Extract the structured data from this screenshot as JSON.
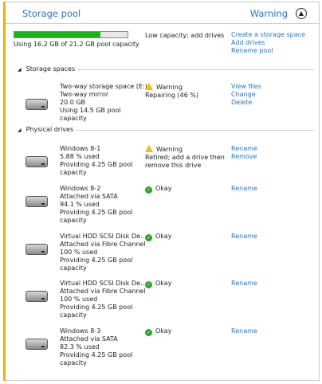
{
  "header": {
    "title": "Storage pool",
    "status": "Warning",
    "collapse_icon": "chevron-up-icon"
  },
  "pool": {
    "usage_fraction": 0.764,
    "usage_text": "Using 16.2 GB of 21.2 GB pool capacity",
    "capacity_warning": "Low capacity; add drives",
    "actions": [
      "Create a storage space",
      "Add drives",
      "Rename pool"
    ]
  },
  "storage_spaces": {
    "heading": "Storage spaces",
    "items": [
      {
        "lines": [
          "Two-way storage space (E:)",
          "Two-way mirror",
          "20.0 GB",
          "Using 14.5 GB pool capacity"
        ],
        "state": [
          "Warning",
          "Repairing (46 %)"
        ],
        "actions": [
          "View files",
          "Change",
          "Delete"
        ]
      }
    ]
  },
  "physical_drives": {
    "heading": "Physical drives",
    "items": [
      {
        "lines": [
          "Windows 8-1",
          "5.88 % used",
          "Providing 4.25 GB pool",
          "capacity"
        ],
        "state": [
          "Warning",
          "Retired; add a drive then",
          "remove this drive"
        ],
        "actions": [
          "Rename",
          "Remove"
        ]
      },
      {
        "lines": [
          "Windows 8-2",
          "Attached via SATA",
          "94.1 % used",
          "Providing 4.25 GB pool",
          "capacity"
        ],
        "state": [
          "Okay"
        ],
        "actions": [
          "Rename"
        ]
      },
      {
        "lines": [
          "Virtual HDD SCSI Disk De...",
          "Attached via Fibre Channel",
          "100 % used",
          "Providing 4.25 GB pool",
          "capacity"
        ],
        "state": [
          "Okay"
        ],
        "actions": [
          "Rename"
        ]
      },
      {
        "lines": [
          "Virtual HDD SCSI Disk De...",
          "Attached via Fibre Channel",
          "100 % used",
          "Providing 4.25 GB pool",
          "capacity"
        ],
        "state": [
          "Okay"
        ],
        "actions": [
          "Rename"
        ]
      },
      {
        "lines": [
          "Windows 8-3",
          "Attached via SATA",
          "82.3 % used",
          "Providing 4.25 GB pool",
          "capacity"
        ],
        "state": [
          "Okay"
        ],
        "actions": [
          "Rename"
        ]
      }
    ]
  },
  "colors": {
    "accent": "#e8b400",
    "link": "#2a73c5",
    "ok": "#2aa52a",
    "warning": "#f2c100",
    "bar_fill": "#1db21d"
  }
}
